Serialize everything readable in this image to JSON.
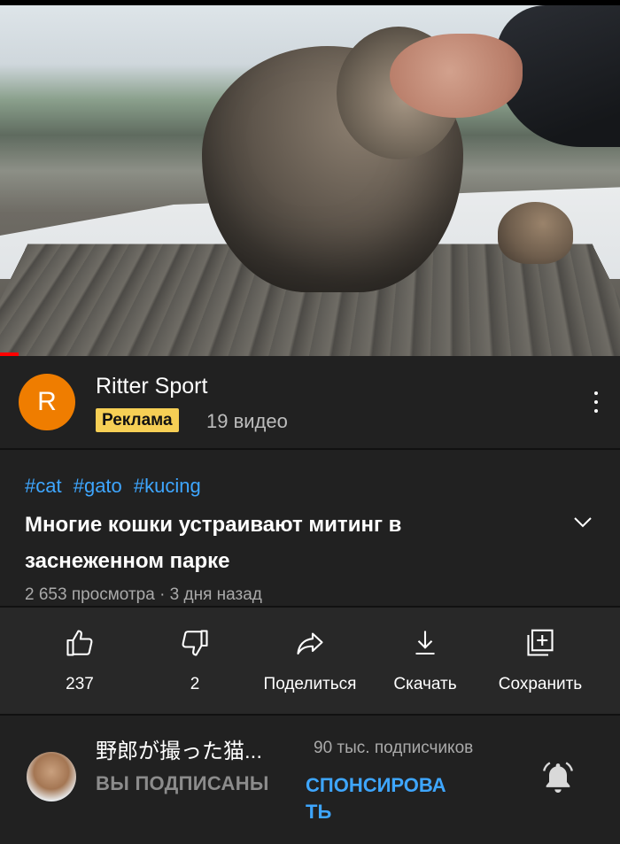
{
  "video": {
    "progress_fraction": 0.03
  },
  "ad": {
    "logo_letter": "R",
    "title": "Ritter Sport",
    "badge": "Реклама",
    "video_count": "19 видео",
    "logo_color": "#ef7d00",
    "badge_color": "#f6cf55"
  },
  "details": {
    "hashtags": [
      "#cat",
      "#gato",
      "#kucing"
    ],
    "title_line1": "Многие кошки устраивают митинг в",
    "title_line2": "заснеженном парке",
    "meta": "2 653 просмотра · 3 дня назад"
  },
  "actions": {
    "like": {
      "label": "237",
      "icon": "thumbs-up-icon"
    },
    "dislike": {
      "label": "2",
      "icon": "thumbs-down-icon"
    },
    "share": {
      "label": "Поделиться",
      "icon": "share-icon"
    },
    "download": {
      "label": "Скачать",
      "icon": "download-icon"
    },
    "save": {
      "label": "Сохранить",
      "icon": "add-to-playlist-icon"
    }
  },
  "channel": {
    "name": "野郎が撮った猫...",
    "subscribers": "90 тыс. подписчиков",
    "subscribed_label": "ВЫ ПОДПИСАНЫ",
    "sponsor_label": "СПОНСИРОВАТЬ",
    "bell_icon": "notification-bell-icon"
  },
  "colors": {
    "link_blue": "#3ea6ff",
    "background": "#212121",
    "actions_background": "#282828"
  }
}
